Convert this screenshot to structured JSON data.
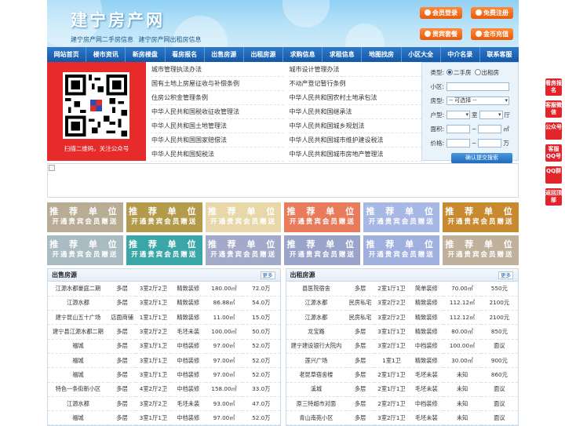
{
  "header": {
    "logo": "建宁房产网",
    "slogan": "建宁房产网二手房信息 建宁房产网出租房信息",
    "buttons": [
      "会员登录",
      "免费注册",
      "贵宾套餐",
      "金币充值"
    ]
  },
  "nav": [
    "网站首页",
    "楼市资讯",
    "新房楼盘",
    "看房报名",
    "出售房源",
    "出租房源",
    "求购信息",
    "求租信息",
    "地图找房",
    "小区大全",
    "中介名录",
    "联系客服"
  ],
  "qr_caption": "扫描二维码，关注公众号",
  "laws_left": [
    "城市管理执法办法",
    "国有土地上房屋征收与补偿条例",
    "住房公积金管理条例",
    "中华人民共和国税收征收管理法",
    "中华人民共和国土地管理法",
    "中华人民共和国国家赔偿法",
    "中华人民共和国契税法"
  ],
  "laws_right": [
    "城市设计管理办法",
    "不动产登记暂行条例",
    "中华人民共和国农村土地承包法",
    "中华人民共和国继承法",
    "中华人民共和国城乡规划法",
    "中华人民共和国城市维护建设税法",
    "中华人民共和国城市房地产管理法"
  ],
  "search": {
    "type_label": "类型:",
    "opt_sale": "二手房",
    "opt_rent": "出租房",
    "community_label": "小区:",
    "housetype_label": "房型:",
    "housetype_value": "-- 可选择 --",
    "layout_label": "户型:",
    "room": "室",
    "hall": "厅",
    "area_label": "面积:",
    "area_unit": "㎡",
    "price_label": "价格:",
    "price_unit": "万",
    "tilde": "~",
    "submit": "确认提交搜索"
  },
  "ad_line1": "推 荐 单 位",
  "ad_line2": "开通贵宾会员赠送",
  "ad_colors": [
    "#b8ac95",
    "#b49b4c",
    "#e8d7a8",
    "#e97a5a",
    "#a7b8e4",
    "#c88a2e",
    "#a9bcc2",
    "#3aa6a8",
    "#a3a9c9",
    "#9aa3c9",
    "#9fb0df",
    "#bfb19b"
  ],
  "sale": {
    "title": "出售房源",
    "more": "更多",
    "rows": [
      [
        "江源水都豪庭二期",
        "多层",
        "3室2厅2卫",
        "精致装修",
        "180.00㎡",
        "72.0万"
      ],
      [
        "江源水都",
        "多层",
        "3室2厅1卫",
        "精致装修",
        "86.88㎡",
        "54.0万"
      ],
      [
        "建宁昆山五十广场",
        "店面商铺",
        "1室1厅1卫",
        "精致装修",
        "11.00㎡",
        "15.0万"
      ],
      [
        "建宁县江源水都二期",
        "多层",
        "3室2厅2卫",
        "毛坯未装",
        "100.00㎡",
        "50.0万"
      ],
      [
        "福城",
        "多层",
        "3室1厅1卫",
        "中档装修",
        "97.00㎡",
        "52.0万"
      ],
      [
        "福城",
        "多层",
        "3室1厅1卫",
        "中档装修",
        "97.00㎡",
        "52.0万"
      ],
      [
        "福城",
        "多层",
        "3室1厅1卫",
        "中档装修",
        "97.00㎡",
        "52.0万"
      ],
      [
        "特色一条街新小区",
        "多层",
        "4室2厅2卫",
        "中档装修",
        "158.00㎡",
        "33.0万"
      ],
      [
        "江源水都",
        "多层",
        "3室2厅2卫",
        "毛坯未装",
        "93.00㎡",
        "47.0万"
      ],
      [
        "福城",
        "多层",
        "3室1厅1卫",
        "中档装修",
        "97.00㎡",
        "52.0万"
      ]
    ]
  },
  "rent": {
    "title": "出租房源",
    "more": "更多",
    "rows": [
      [
        "县医院宿舍",
        "多层",
        "2室1厅1卫",
        "简单装修",
        "70.00㎡",
        "550元"
      ],
      [
        "江源水都",
        "民房私宅",
        "3室2厅2卫",
        "精致装修",
        "112.12㎡",
        "2100元"
      ],
      [
        "江源水都",
        "民房私宅",
        "3室2厅2卫",
        "精致装修",
        "112.12㎡",
        "2100元"
      ],
      [
        "龙宝路",
        "多层",
        "3室1厅1卫",
        "精致装修",
        "80.00㎡",
        "850元"
      ],
      [
        "建宁建设银行大院内",
        "多层",
        "3室2厅1卫",
        "中档装修",
        "100.00㎡",
        "面议"
      ],
      [
        "莲兴广场",
        "多层",
        "1室1卫",
        "精致装修",
        "30.00㎡",
        "900元"
      ],
      [
        "老昆草宿舍楼",
        "多层",
        "2室1厅1卫",
        "毛坯未装",
        "未知",
        "860元"
      ],
      [
        "溪城",
        "多层",
        "2室1厅1卫",
        "毛坯未装",
        "未知",
        "面议"
      ],
      [
        "原三特超市对面",
        "多层",
        "2室2厅1卫",
        "中档装修",
        "未知",
        "面议"
      ],
      [
        "青山南苑小区",
        "多层",
        "3室2厅1卫",
        "毛坯未装",
        "未知",
        "面议"
      ]
    ]
  },
  "sidebar": [
    "看房报名",
    "客服微信",
    "公众号",
    "客服QQ号",
    "QQ群",
    "返回顶部"
  ]
}
